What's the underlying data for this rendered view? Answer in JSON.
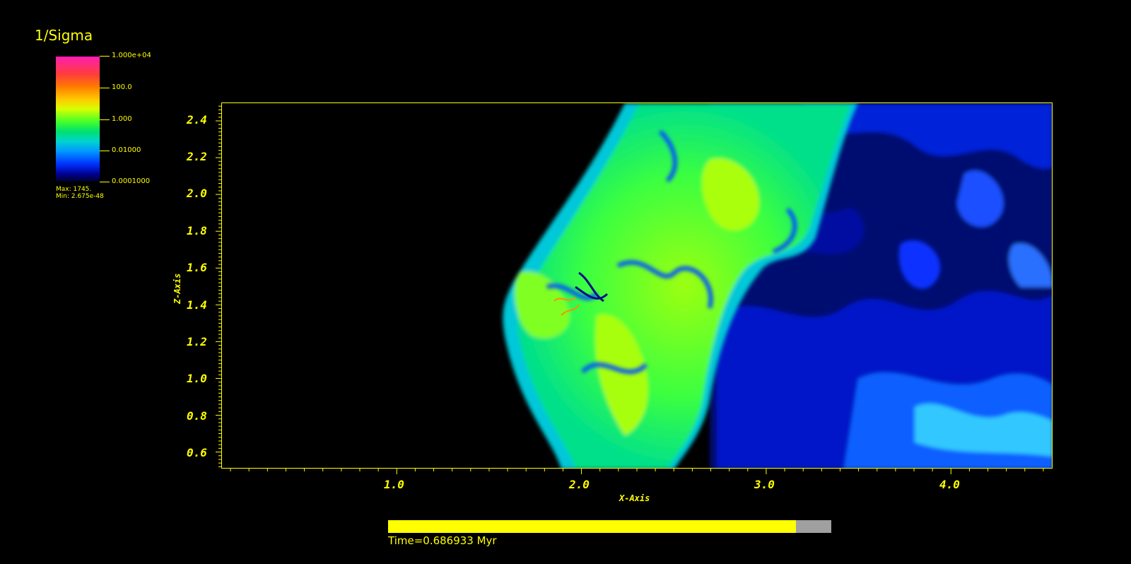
{
  "variable_title": "1/Sigma",
  "legend": {
    "ticks": [
      "1.000e+04",
      "100.0",
      "1.000",
      "0.01000",
      "0.0001000"
    ],
    "max_text": "Max:  1745.",
    "min_text": "Min:  2.675e-48"
  },
  "axes": {
    "x_title": "X-Axis",
    "z_title": "Z-Axis",
    "x_ticks": [
      "1.0",
      "2.0",
      "3.0",
      "4.0"
    ],
    "z_ticks": [
      "2.4",
      "2.2",
      "2.0",
      "1.8",
      "1.6",
      "1.4",
      "1.2",
      "1.0",
      "0.8",
      "0.6"
    ],
    "x_range": [
      0.05,
      4.55
    ],
    "z_range": [
      0.51,
      2.5
    ]
  },
  "time": {
    "label": "Time=0.686933 Myr",
    "progress": 0.92
  },
  "colors": {
    "text": "#ffff00",
    "background": "#000000"
  }
}
